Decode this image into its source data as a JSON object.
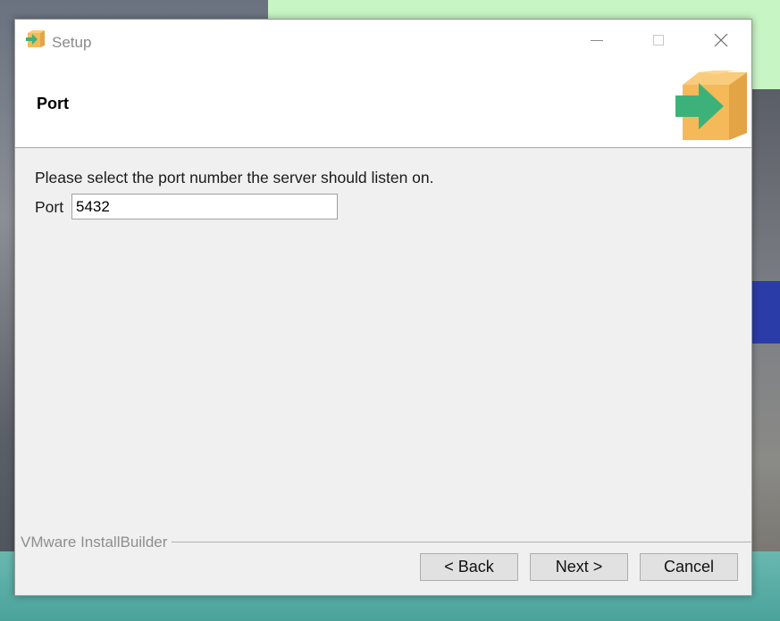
{
  "window": {
    "title": "Setup",
    "app_icon": "installer-box-arrow-icon",
    "controls": {
      "minimize": "minimize-icon",
      "maximize": "maximize-icon",
      "close": "close-icon"
    }
  },
  "header": {
    "title": "Port",
    "logo": "installer-box-arrow-icon"
  },
  "content": {
    "prompt": "Please select the port number the server should listen on.",
    "port_label": "Port",
    "port_value": "5432"
  },
  "footer": {
    "brand": "VMware InstallBuilder",
    "back_label": "< Back",
    "next_label": "Next >",
    "cancel_label": "Cancel"
  },
  "colors": {
    "accent_box": "#f5b95a",
    "accent_arrow": "#3cb27a"
  }
}
